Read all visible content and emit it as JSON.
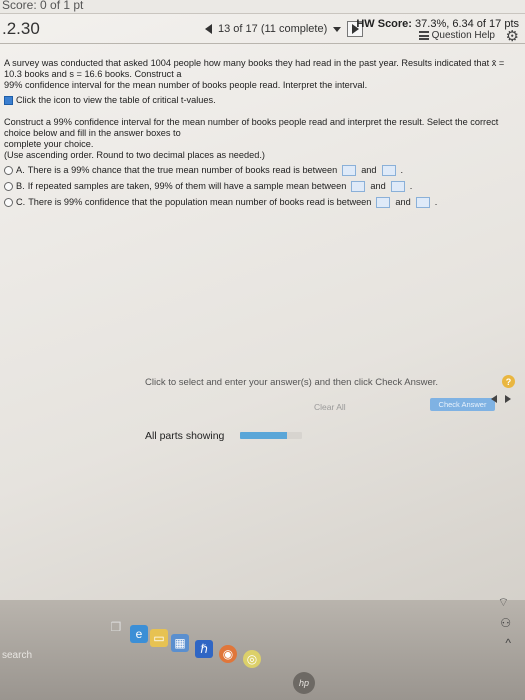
{
  "topbar": {
    "score_text": "Score: 0 of 1 pt"
  },
  "header": {
    "question_number": ".2.30",
    "nav_text": "13 of 17 (11 complete)",
    "hw_label": "HW Score:",
    "hw_value": "37.3%, 6.34 of 17 pts",
    "question_help": "Question Help"
  },
  "question": {
    "prompt_line1": "A survey was conducted that asked 1004 people how many books they had read in the past year. Results indicated that x̄ = 10.3 books and s = 16.6 books. Construct a",
    "prompt_line2": "99% confidence interval for the mean number of books people read. Interpret the interval.",
    "tables_link": "Click the icon to view the table of critical t-values.",
    "instruction_line1": "Construct a 99% confidence interval for the mean number of books people read and interpret the result. Select the correct choice below and fill in the answer boxes to",
    "instruction_line2": "complete your choice.",
    "instruction_line3": "(Use ascending order. Round to two decimal places as needed.)"
  },
  "choices": [
    {
      "letter": "A.",
      "text_before": "There is a 99% chance that the true mean number of books read is between",
      "text_mid": "and",
      "text_after": "."
    },
    {
      "letter": "B.",
      "text_before": "If repeated samples are taken, 99% of them will have a sample mean between",
      "text_mid": "and",
      "text_after": "."
    },
    {
      "letter": "C.",
      "text_before": "There is 99% confidence that the population mean number of books read is between",
      "text_mid": "and",
      "text_after": "."
    }
  ],
  "footer": {
    "instruction": "Click to select and enter your answer(s) and then click Check Answer.",
    "clear_all": "Clear All",
    "check_answer": "Check Answer",
    "help_symbol": "?",
    "parts_showing": "All parts showing",
    "progress_fraction": 0.75
  },
  "taskbar": {
    "search_label": "search",
    "hp_label": "hp"
  },
  "colors": {
    "accent": "#5aa6d8",
    "answer_box": "#dfeaf8",
    "help_badge": "#e9b640"
  }
}
